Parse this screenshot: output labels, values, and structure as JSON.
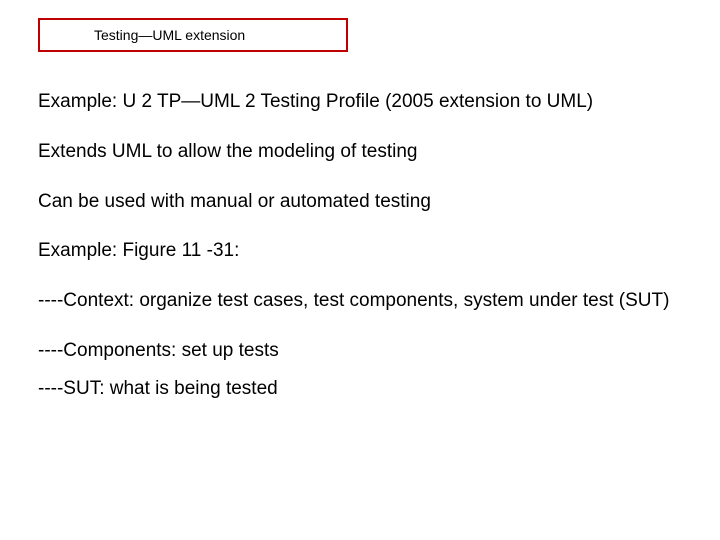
{
  "title": "Testing—UML extension",
  "body": {
    "p1": "Example:  U 2 TP—UML 2 Testing Profile (2005 extension to UML)",
    "p2": "Extends UML to allow the modeling of testing",
    "p3": "Can be used with manual or automated testing",
    "p4": "Example:  Figure 11 -31:",
    "p5": "----Context:  organize test cases, test components, system under test (SUT)",
    "p6": "----Components:  set up tests",
    "p7": "----SUT:  what is being tested"
  }
}
